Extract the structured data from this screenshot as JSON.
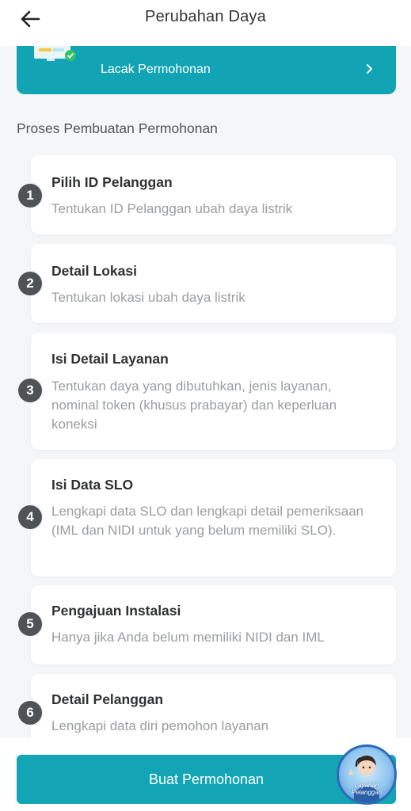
{
  "header": {
    "title": "Perubahan Daya"
  },
  "banner": {
    "label": "Lacak Permohonan"
  },
  "section_title": "Proses Pembuatan Permohonan",
  "steps": [
    {
      "number": "1",
      "title": "Pilih ID Pelanggan",
      "desc": "Tentukan ID Pelanggan ubah daya listrik"
    },
    {
      "number": "2",
      "title": "Detail Lokasi",
      "desc": "Tentukan lokasi ubah daya listrik"
    },
    {
      "number": "3",
      "title": "Isi Detail Layanan",
      "desc": "Tentukan daya yang dibutuhkan, jenis layanan, nominal token (khusus prabayar) dan keperluan koneksi"
    },
    {
      "number": "4",
      "title": "Isi Data SLO",
      "desc": "Lengkapi data SLO dan lengkapi detail pemeriksaan (IML dan NIDI untuk yang belum memiliki SLO)."
    },
    {
      "number": "5",
      "title": "Pengajuan Instalasi",
      "desc": "Hanya jika Anda belum memiliki NIDI dan IML"
    },
    {
      "number": "6",
      "title": "Detail Pelanggan",
      "desc": "Lengkapi data diri pemohon layanan"
    }
  ],
  "primary_button": {
    "label": "Buat Permohonan"
  },
  "cs_fab": {
    "line1": "Layanan",
    "line2": "Pelanggan"
  },
  "colors": {
    "accent": "#12a4b4",
    "step_badge": "#505355",
    "background": "#f5f6f7"
  }
}
